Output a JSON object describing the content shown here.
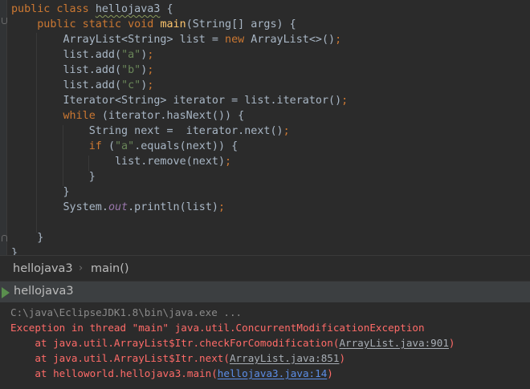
{
  "editor": {
    "lines": [
      [
        {
          "t": "public class ",
          "c": "kw"
        },
        {
          "t": "hellojava3",
          "c": "plain squiggle"
        },
        {
          "t": " {",
          "c": "plain"
        }
      ],
      [
        {
          "t": "    public static void ",
          "c": "kw"
        },
        {
          "t": "main",
          "c": "fn"
        },
        {
          "t": "(String[] args) {",
          "c": "plain"
        }
      ],
      [
        {
          "t": "        ArrayList<String> list = ",
          "c": "plain"
        },
        {
          "t": "new ",
          "c": "kw"
        },
        {
          "t": "ArrayList<>()",
          "c": "plain"
        },
        {
          "t": ";",
          "c": "kw"
        }
      ],
      [
        {
          "t": "        list.add(",
          "c": "plain"
        },
        {
          "t": "\"a\"",
          "c": "str"
        },
        {
          "t": ")",
          "c": "plain"
        },
        {
          "t": ";",
          "c": "kw"
        }
      ],
      [
        {
          "t": "        list.add(",
          "c": "plain"
        },
        {
          "t": "\"b\"",
          "c": "str"
        },
        {
          "t": ")",
          "c": "plain"
        },
        {
          "t": ";",
          "c": "kw"
        }
      ],
      [
        {
          "t": "        list.add(",
          "c": "plain"
        },
        {
          "t": "\"c\"",
          "c": "str"
        },
        {
          "t": ")",
          "c": "plain"
        },
        {
          "t": ";",
          "c": "kw"
        }
      ],
      [
        {
          "t": "        Iterator<String> iterator = list.iterator()",
          "c": "plain"
        },
        {
          "t": ";",
          "c": "kw"
        }
      ],
      [
        {
          "t": "        ",
          "c": "plain"
        },
        {
          "t": "while ",
          "c": "kw"
        },
        {
          "t": "(iterator.hasNext()) {",
          "c": "plain"
        }
      ],
      [
        {
          "t": "            String next =  iterator.next()",
          "c": "plain"
        },
        {
          "t": ";",
          "c": "kw"
        }
      ],
      [
        {
          "t": "            ",
          "c": "plain"
        },
        {
          "t": "if ",
          "c": "kw"
        },
        {
          "t": "(",
          "c": "plain"
        },
        {
          "t": "\"a\"",
          "c": "str"
        },
        {
          "t": ".equals(next)) {",
          "c": "plain"
        }
      ],
      [
        {
          "t": "                list.remove(next)",
          "c": "plain"
        },
        {
          "t": ";",
          "c": "kw"
        }
      ],
      [
        {
          "t": "            }",
          "c": "plain"
        }
      ],
      [
        {
          "t": "        }",
          "c": "plain"
        }
      ],
      [
        {
          "t": "        System.",
          "c": "plain"
        },
        {
          "t": "out",
          "c": "static-field"
        },
        {
          "t": ".println(list)",
          "c": "plain"
        },
        {
          "t": ";",
          "c": "kw"
        }
      ],
      [],
      [
        {
          "t": "    }",
          "c": "plain"
        }
      ],
      [
        {
          "t": "}",
          "c": "plain"
        }
      ]
    ]
  },
  "breadcrumb": {
    "class_name": "hellojava3",
    "separator": "›",
    "method_name": "main()"
  },
  "run_window": {
    "tab_label": "hellojava3",
    "tab_icon": "run-config-icon"
  },
  "console": {
    "command": "C:\\java\\EclipseJDK1.8\\bin\\java.exe ...",
    "exception": "Exception in thread \"main\" java.util.ConcurrentModificationException",
    "stack": [
      {
        "prefix": "    at java.util.ArrayList$Itr.checkForComodification(",
        "link": "ArrayList.java:901",
        "suffix": ")",
        "visited": true
      },
      {
        "prefix": "    at java.util.ArrayList$Itr.next(",
        "link": "ArrayList.java:851",
        "suffix": ")",
        "visited": true
      },
      {
        "prefix": "    at helloworld.hellojava3.main(",
        "link": "hellojava3.java:14",
        "suffix": ")",
        "visited": false
      }
    ]
  },
  "colors": {
    "background": "#2b2b2b",
    "keyword": "#cc7832",
    "method": "#ffc66d",
    "string": "#6a8759",
    "static_field": "#9876aa",
    "default_text": "#a9b7c6",
    "error_text": "#ff6b68",
    "link": "#5c8ee8"
  }
}
